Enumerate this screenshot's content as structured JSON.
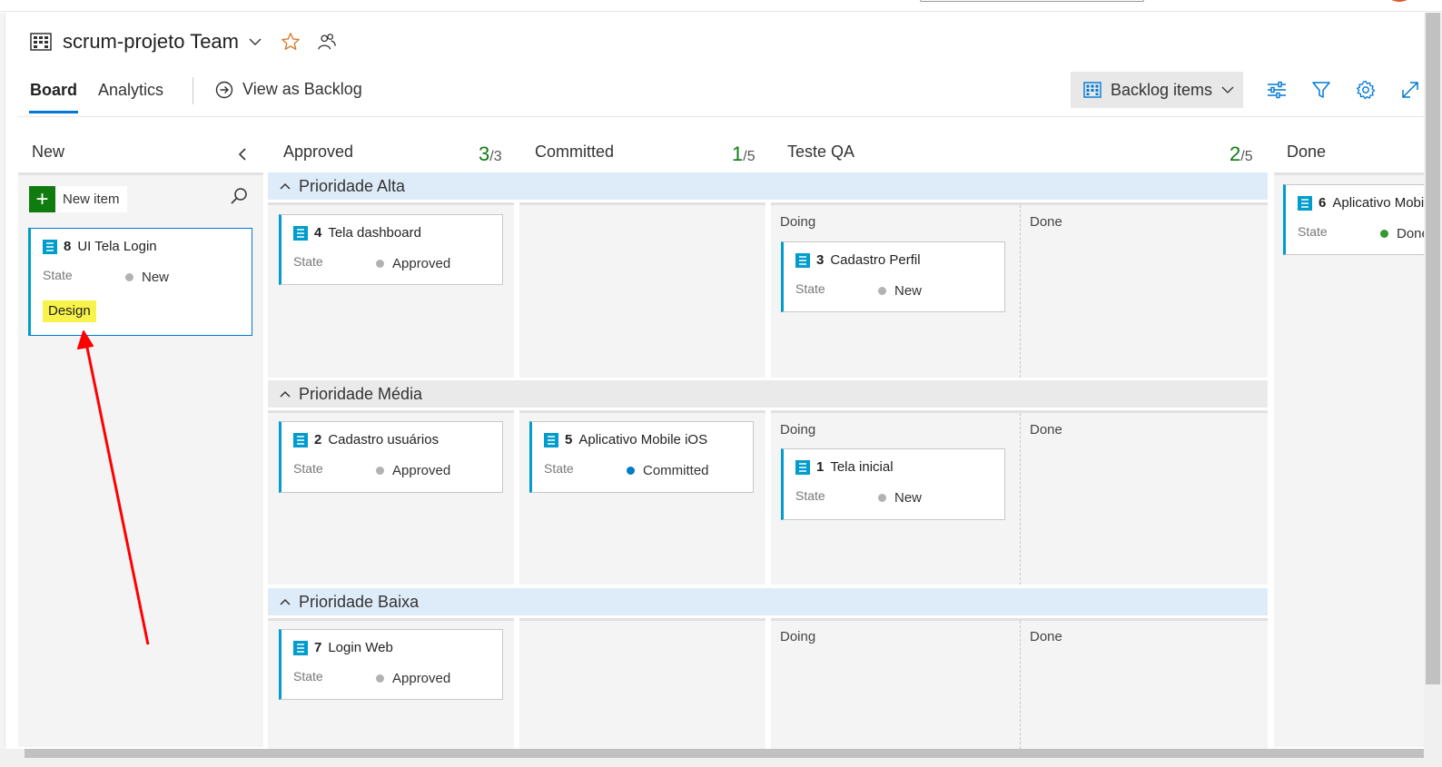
{
  "header": {
    "team_name": "scrum-projeto Team",
    "icons": [
      "board-icon",
      "chevron-down-icon",
      "star-icon",
      "people-icon"
    ]
  },
  "tabs": [
    {
      "label": "Board",
      "active": true
    },
    {
      "label": "Analytics",
      "active": false
    }
  ],
  "view_as_backlog": "View as Backlog",
  "toolbar": {
    "backlog_level": "Backlog items",
    "icons": [
      "settings-sliders-icon",
      "filter-icon",
      "gear-icon",
      "expand-icon"
    ]
  },
  "columns": {
    "new": {
      "name": "New"
    },
    "approved": {
      "name": "Approved",
      "count": "3",
      "limit": "/3"
    },
    "committed": {
      "name": "Committed",
      "count": "1",
      "limit": "/5"
    },
    "testeqa": {
      "name": "Teste QA",
      "count": "2",
      "limit": "/5",
      "sub": [
        "Doing",
        "Done"
      ]
    },
    "done": {
      "name": "Done"
    }
  },
  "new_item_label": "New item",
  "swimlanes": [
    {
      "name": "Prioridade Alta"
    },
    {
      "name": "Prioridade Média"
    },
    {
      "name": "Prioridade Baixa"
    }
  ],
  "cards": {
    "c8": {
      "id": "8",
      "title": "UI Tela Login",
      "state_label": "State",
      "state": "New",
      "tag": "Design"
    },
    "c4": {
      "id": "4",
      "title": "Tela dashboard",
      "state_label": "State",
      "state": "Approved"
    },
    "c3": {
      "id": "3",
      "title": "Cadastro Perfil",
      "state_label": "State",
      "state": "New"
    },
    "c6": {
      "id": "6",
      "title": "Aplicativo Mobile",
      "state_label": "State",
      "state": "Done"
    },
    "c2": {
      "id": "2",
      "title": "Cadastro usuários",
      "state_label": "State",
      "state": "Approved"
    },
    "c5": {
      "id": "5",
      "title": "Aplicativo Mobile iOS",
      "state_label": "State",
      "state": "Committed"
    },
    "c1": {
      "id": "1",
      "title": "Tela inicial",
      "state_label": "State",
      "state": "New"
    },
    "c7": {
      "id": "7",
      "title": "Login Web",
      "state_label": "State",
      "state": "Approved"
    }
  },
  "colors": {
    "accent": "#0078d4",
    "card_border": "#009ccc",
    "count_green": "#107c10",
    "state_new": "#b2b2b2",
    "state_approved": "#b2b2b2",
    "state_committed": "#007acc",
    "state_done": "#339933",
    "tag_bg": "#f8f34a",
    "annotation_arrow": "#ff0000"
  }
}
